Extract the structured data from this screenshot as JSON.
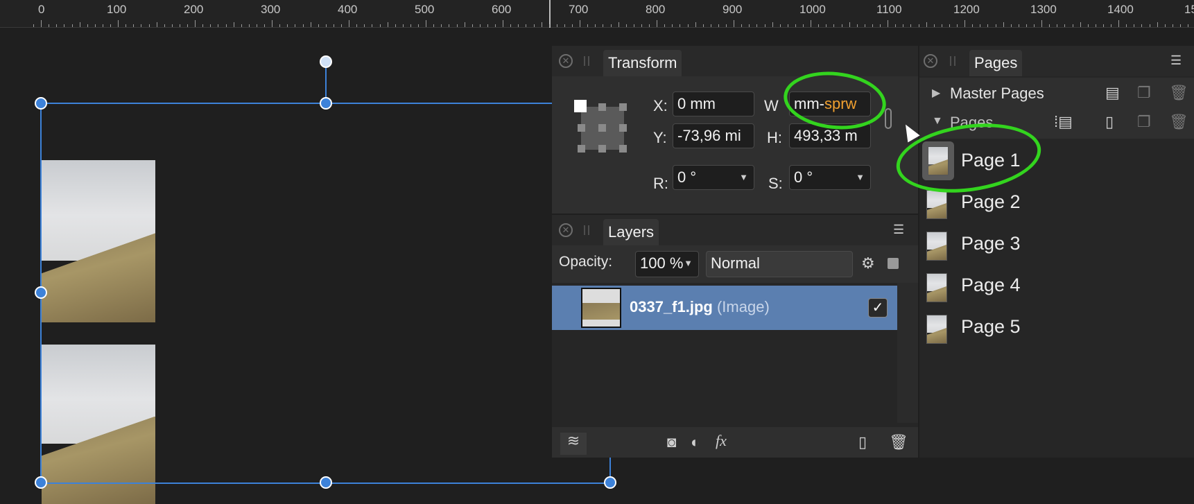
{
  "ruler": {
    "labels": [
      "0",
      "100",
      "200",
      "300",
      "400",
      "500",
      "600",
      "700",
      "800",
      "900",
      "1000",
      "1100",
      "1200",
      "1300",
      "1400",
      "15"
    ]
  },
  "transform": {
    "tab_label": "Transform",
    "x_label": "X:",
    "x_value": "0 mm",
    "y_label": "Y:",
    "y_value": "-73,96 mi",
    "w_label": "W",
    "w_value_prefix": "mm-",
    "w_value_suffix": "sprw",
    "h_label": "H:",
    "h_value": "493,33 m",
    "r_label": "R:",
    "r_value": "0 °",
    "s_label": "S:",
    "s_value": "0 °"
  },
  "layers": {
    "tab_label": "Layers",
    "opacity_label": "Opacity:",
    "opacity_value": "100 %",
    "blend_mode": "Normal",
    "items": [
      {
        "name": "0337_f1.jpg",
        "type": "(Image)",
        "visible": true
      }
    ]
  },
  "pages": {
    "tab_label": "Pages",
    "master_pages_label": "Master Pages",
    "pages_section_label": "Pages",
    "items": [
      {
        "label": "Page 1"
      },
      {
        "label": "Page 2"
      },
      {
        "label": "Page 3"
      },
      {
        "label": "Page 4"
      },
      {
        "label": "Page 5"
      }
    ]
  },
  "colors": {
    "accent": "#3d82d9",
    "highlight_ring": "#33d41e",
    "selected_layer": "#5b7fb0",
    "sprw_text": "#f0a030"
  }
}
